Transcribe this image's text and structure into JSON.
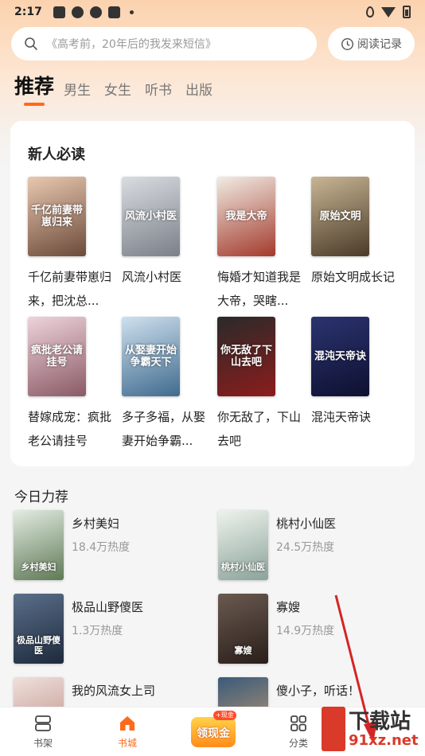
{
  "status_bar": {
    "time": "2:17"
  },
  "search": {
    "placeholder": "《高考前，20年后的我发来短信》"
  },
  "history": {
    "label": "阅读记录"
  },
  "tabs": [
    {
      "label": "推荐"
    },
    {
      "label": "男生"
    },
    {
      "label": "女生"
    },
    {
      "label": "听书"
    },
    {
      "label": "出版"
    }
  ],
  "new_reader": {
    "title": "新人必读",
    "books": [
      {
        "title": "千亿前妻带崽归来，把沈总...",
        "cover_text": "千亿前妻带崽归来",
        "color1": "#e9c8b0",
        "color2": "#6b4a3a"
      },
      {
        "title": "风流小村医",
        "cover_text": "风流小村医",
        "color1": "#d9dde2",
        "color2": "#7b8088"
      },
      {
        "title": "悔婚才知道我是大帝，哭瞎...",
        "cover_text": "我是大帝",
        "color1": "#f1ece4",
        "color2": "#a33a2c"
      },
      {
        "title": "原始文明成长记",
        "cover_text": "原始文明",
        "color1": "#c8b594",
        "color2": "#4a3b28"
      },
      {
        "title": "替嫁成宠：疯批老公请挂号",
        "cover_text": "疯批老公请挂号",
        "color1": "#eed3da",
        "color2": "#8a5a66"
      },
      {
        "title": "多子多福，从娶妻开始争霸...",
        "cover_text": "从娶妻开始争霸天下",
        "color1": "#cfe0ee",
        "color2": "#3f6b8e"
      },
      {
        "title": "你无敌了，下山去吧",
        "cover_text": "你无敌了下山去吧",
        "color1": "#2a2a2a",
        "color2": "#8c1c1c"
      },
      {
        "title": "混沌天帝诀",
        "cover_text": "混沌天帝诀",
        "color1": "#2b3470",
        "color2": "#0e1030"
      }
    ]
  },
  "today": {
    "title": "今日力荐",
    "items": [
      {
        "name": "乡村美妇",
        "heat": "18.4万热度",
        "cover_text": "乡村美妇",
        "color1": "#e3ece2",
        "color2": "#5f7a56"
      },
      {
        "name": "桃村小仙医",
        "heat": "24.5万热度",
        "cover_text": "桃村小仙医",
        "color1": "#eef3ec",
        "color2": "#8aa39a"
      },
      {
        "name": "极品山野傻医",
        "heat": "1.3万热度",
        "cover_text": "极品山野傻医",
        "color1": "#5a6f8a",
        "color2": "#1e2a3d"
      },
      {
        "name": "寡嫂",
        "heat": "14.9万热度",
        "cover_text": "寡嫂",
        "color1": "#6a5a50",
        "color2": "#2a1e1a"
      },
      {
        "name": "我的风流女上司",
        "heat": "",
        "cover_text": "",
        "color1": "#f0e0dc",
        "color2": "#b88a80"
      },
      {
        "name": "傻小子，听话！",
        "heat": "",
        "cover_text": "",
        "color1": "#3a5a7a",
        "color2": "#caa070"
      }
    ]
  },
  "bottom_nav": {
    "bookshelf": "书架",
    "store": "书城",
    "cash": "领现金",
    "cash_badge": "+现金",
    "category": "分类"
  },
  "watermark": {
    "brand": "下载站",
    "url": "91xz.net"
  },
  "colors": {
    "accent": "#ff6a1a",
    "annotation": "#d62424"
  }
}
